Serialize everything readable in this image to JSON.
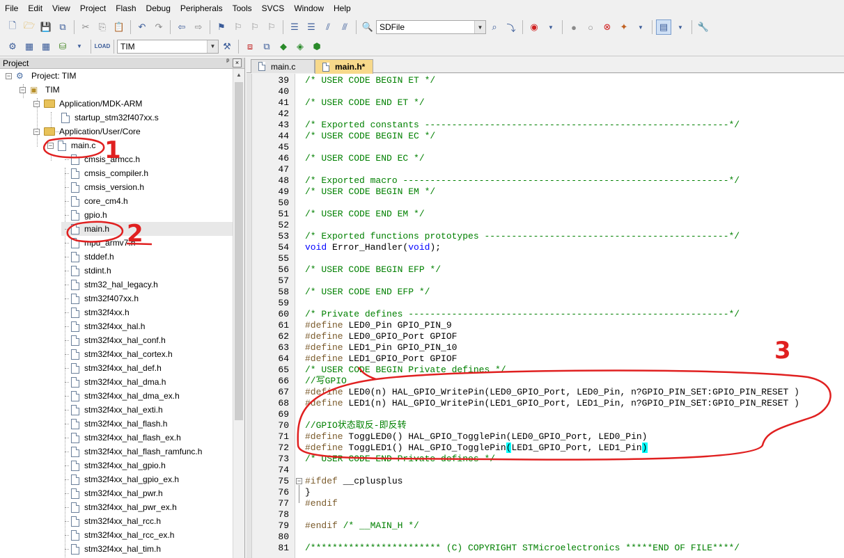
{
  "menu": [
    "File",
    "Edit",
    "View",
    "Project",
    "Flash",
    "Debug",
    "Peripherals",
    "Tools",
    "SVCS",
    "Window",
    "Help"
  ],
  "toolbar1": {
    "target_combo": "SDFile"
  },
  "toolbar2": {
    "target_combo": "TIM"
  },
  "project_panel": {
    "title": "Project",
    "pin": "ᵖ",
    "close": "×",
    "root": "Project: TIM",
    "target": "TIM",
    "folders": [
      "Application/MDK-ARM",
      "Application/User/Core"
    ],
    "startup_file": "startup_stm32f407xx.s",
    "main_c": "main.c",
    "files": [
      "cmsis_armcc.h",
      "cmsis_compiler.h",
      "cmsis_version.h",
      "core_cm4.h",
      "gpio.h",
      "main.h",
      "mpu_armv7.h",
      "stddef.h",
      "stdint.h",
      "stm32_hal_legacy.h",
      "stm32f407xx.h",
      "stm32f4xx.h",
      "stm32f4xx_hal.h",
      "stm32f4xx_hal_conf.h",
      "stm32f4xx_hal_cortex.h",
      "stm32f4xx_hal_def.h",
      "stm32f4xx_hal_dma.h",
      "stm32f4xx_hal_dma_ex.h",
      "stm32f4xx_hal_exti.h",
      "stm32f4xx_hal_flash.h",
      "stm32f4xx_hal_flash_ex.h",
      "stm32f4xx_hal_flash_ramfunc.h",
      "stm32f4xx_hal_gpio.h",
      "stm32f4xx_hal_gpio_ex.h",
      "stm32f4xx_hal_pwr.h",
      "stm32f4xx_hal_pwr_ex.h",
      "stm32f4xx_hal_rcc.h",
      "stm32f4xx_hal_rcc_ex.h",
      "stm32f4xx_hal_tim.h"
    ]
  },
  "tabs": [
    "main.c",
    "main.h*"
  ],
  "editor": {
    "first_line": 39,
    "lines": [
      "/* USER CODE BEGIN ET */",
      "",
      "/* USER CODE END ET */",
      "",
      "/* Exported constants --------------------------------------------------------*/",
      "/* USER CODE BEGIN EC */",
      "",
      "/* USER CODE END EC */",
      "",
      "/* Exported macro ------------------------------------------------------------*/",
      "/* USER CODE BEGIN EM */",
      "",
      "/* USER CODE END EM */",
      "",
      "/* Exported functions prototypes ---------------------------------------------*/",
      "void Error_Handler(void);",
      "",
      "/* USER CODE BEGIN EFP */",
      "",
      "/* USER CODE END EFP */",
      "",
      "/* Private defines -----------------------------------------------------------*/",
      "#define LED0_Pin GPIO_PIN_9",
      "#define LED0_GPIO_Port GPIOF",
      "#define LED1_Pin GPIO_PIN_10",
      "#define LED1_GPIO_Port GPIOF",
      "/* USER CODE BEGIN Private defines */",
      "//写GPIO",
      "#define LED0(n) HAL_GPIO_WritePin(LED0_GPIO_Port, LED0_Pin, n?GPIO_PIN_SET:GPIO_PIN_RESET )",
      "#define LED1(n) HAL_GPIO_WritePin(LED1_GPIO_Port, LED1_Pin, n?GPIO_PIN_SET:GPIO_PIN_RESET )",
      "",
      "//GPIO状态取反-即反转",
      "#define ToggLED0() HAL_GPIO_TogglePin(LED0_GPIO_Port, LED0_Pin)",
      "#define ToggLED1() HAL_GPIO_TogglePin(LED1_GPIO_Port, LED1_Pin)",
      "/* USER CODE END Private defines */",
      "",
      "#ifdef __cplusplus",
      "}",
      "#endif",
      "",
      "#endif /* __MAIN_H */",
      "",
      "/************************ (C) COPYRIGHT STMicroelectronics *****END OF FILE****/"
    ]
  },
  "annotations": [
    "1",
    "2",
    "3"
  ],
  "colors": {
    "annotation": "#e02020",
    "comment": "#008000",
    "keyword": "#0000ff",
    "preprocessor": "#7a5a2a",
    "active_tab": "#f7d98b",
    "bracket_highlight": "#00ffff"
  }
}
